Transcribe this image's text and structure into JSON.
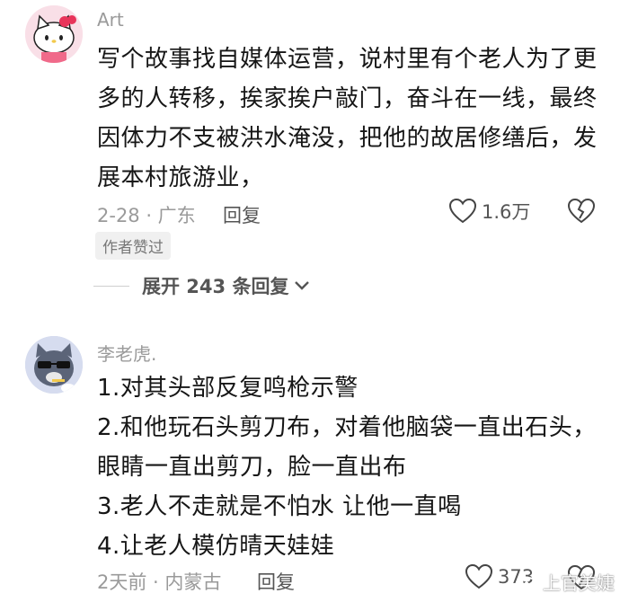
{
  "comments": [
    {
      "username": "Art",
      "avatar_icon": "hello-kitty-avatar",
      "lines": [
        "写个故事找自媒体运营，说村里有个老人为了更",
        "多的人转移，挨家挨户敲门，奋斗在一线，最终",
        "因体力不支被洪水淹没，把他的故居修缮后，发",
        "展本村旅游业，"
      ],
      "meta": "2-28 · 广东",
      "reply_label": "回复",
      "like_count": "1.6万",
      "badge": "作者赞过",
      "expand_label": "展开 243 条回复"
    },
    {
      "username": "李老虎.",
      "avatar_icon": "cartoon-cat-sunglasses-avatar",
      "lines": [
        "1.对其头部反复鸣枪示警",
        "2.和他玩石头剪刀布，对着他脑袋一直出石头，",
        "眼睛一直出剪刀，脸一直出布",
        "3.老人不走就是不怕水 让他一直喝",
        "4.让老人模仿晴天娃娃"
      ],
      "meta": "2天前 · 内蒙古",
      "reply_label": "回复",
      "like_count": "373"
    }
  ],
  "watermark": "上官美婕",
  "colors": {
    "text": "#161616",
    "muted": "#9a9a9a",
    "action": "#555555"
  }
}
